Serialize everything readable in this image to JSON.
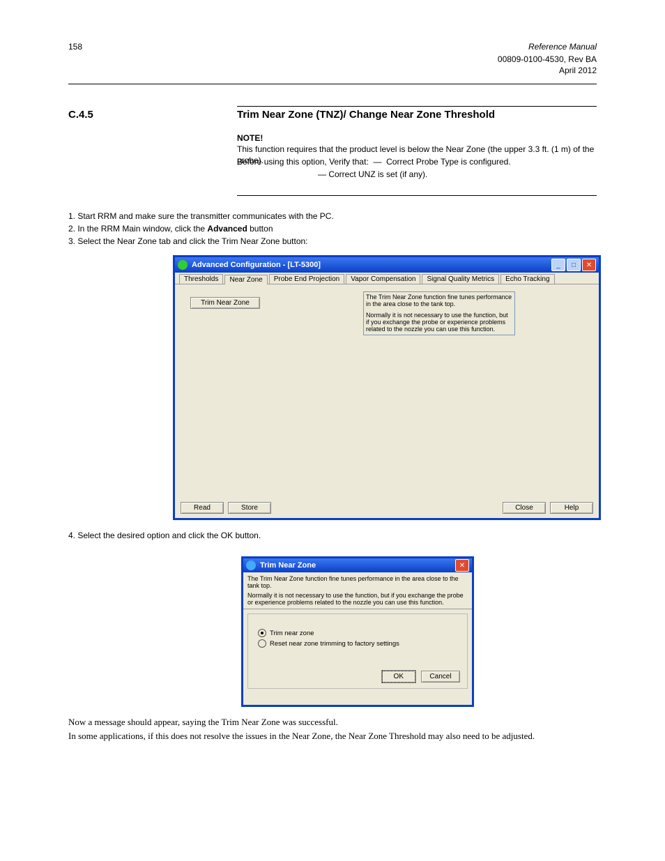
{
  "page": {
    "number": "158",
    "docTitle": "Reference Manual",
    "docId": "00809-0100-4530, Rev BA",
    "date": "April 2012",
    "sectionNum": "C.4.5",
    "sectionTitle": "Trim Near Zone (TNZ)/ Change Near Zone Threshold",
    "noteLabel": "NOTE!",
    "noteText": "This function requires that the product level is below the Near Zone (the upper 3.3 ft. (1 m) of the probe).",
    "point1": "Before using this option, Verify that: ",
    "point2": "Correct Probe Type is configured.",
    "point3": "Correct UNZ is set (if any).",
    "step1": "1. Start RRM and make sure the transmitter communicates with the PC.",
    "step2a": "2. In the RRM Main window, click the ",
    "step2b": "Advanced",
    "step2c": " button",
    "step3": "3. Select the Near Zone tab and click the Trim Near Zone button:",
    "step4": "4. Select the desired option and click the OK button.",
    "p9": "Now a message should appear, saying the Trim Near Zone was successful.",
    "p10": "In some applications, if this does not resolve the issues in the Near Zone, the Near Zone Threshold may also need to be adjusted."
  },
  "win1": {
    "title": "Advanced Configuration - [LT-5300]",
    "tabs": [
      "Thresholds",
      "Near Zone",
      "Probe End Projection",
      "Vapor Compensation",
      "Signal Quality Metrics",
      "Echo Tracking"
    ],
    "trimBtn": "Trim Near Zone",
    "desc1": "The Trim Near Zone function fine tunes performance in the area close to the tank top.",
    "desc2": "Normally it is not necessary to use the function, but if you exchange the probe or experience problems related to the nozzle you can use this function.",
    "read": "Read",
    "store": "Store",
    "close": "Close",
    "help": "Help"
  },
  "win2": {
    "title": "Trim Near Zone",
    "line1": "The Trim Near Zone function fine tunes performance in the area close to the tank top.",
    "line2": "Normally it is not necessary to use the function, but if you exchange the probe or experience problems related to the nozzle you can use this function.",
    "opt1": "Trim near zone",
    "opt2": "Reset near zone trimming to factory settings",
    "ok": "OK",
    "cancel": "Cancel"
  }
}
